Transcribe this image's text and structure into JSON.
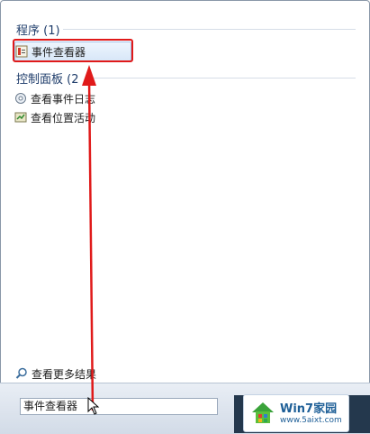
{
  "sections": {
    "programs": {
      "header": "程序 (1)",
      "items": [
        {
          "label": "事件查看器",
          "icon": "event-viewer-icon"
        }
      ]
    },
    "control_panel": {
      "header": "控制面板 (2",
      "items": [
        {
          "label": "查看事件日志",
          "icon": "event-log-icon"
        },
        {
          "label": "查看位置活动",
          "icon": "location-activity-icon"
        }
      ]
    }
  },
  "more_results": {
    "label": "查看更多结果",
    "icon": "search-icon"
  },
  "search": {
    "value": "事件查看器"
  },
  "watermark": {
    "main": "Win7家园",
    "url": "www.5aixt.com"
  },
  "colors": {
    "highlight_border": "#e01a1a",
    "arrow": "#e01a1a",
    "header": "#1f3d6b"
  }
}
